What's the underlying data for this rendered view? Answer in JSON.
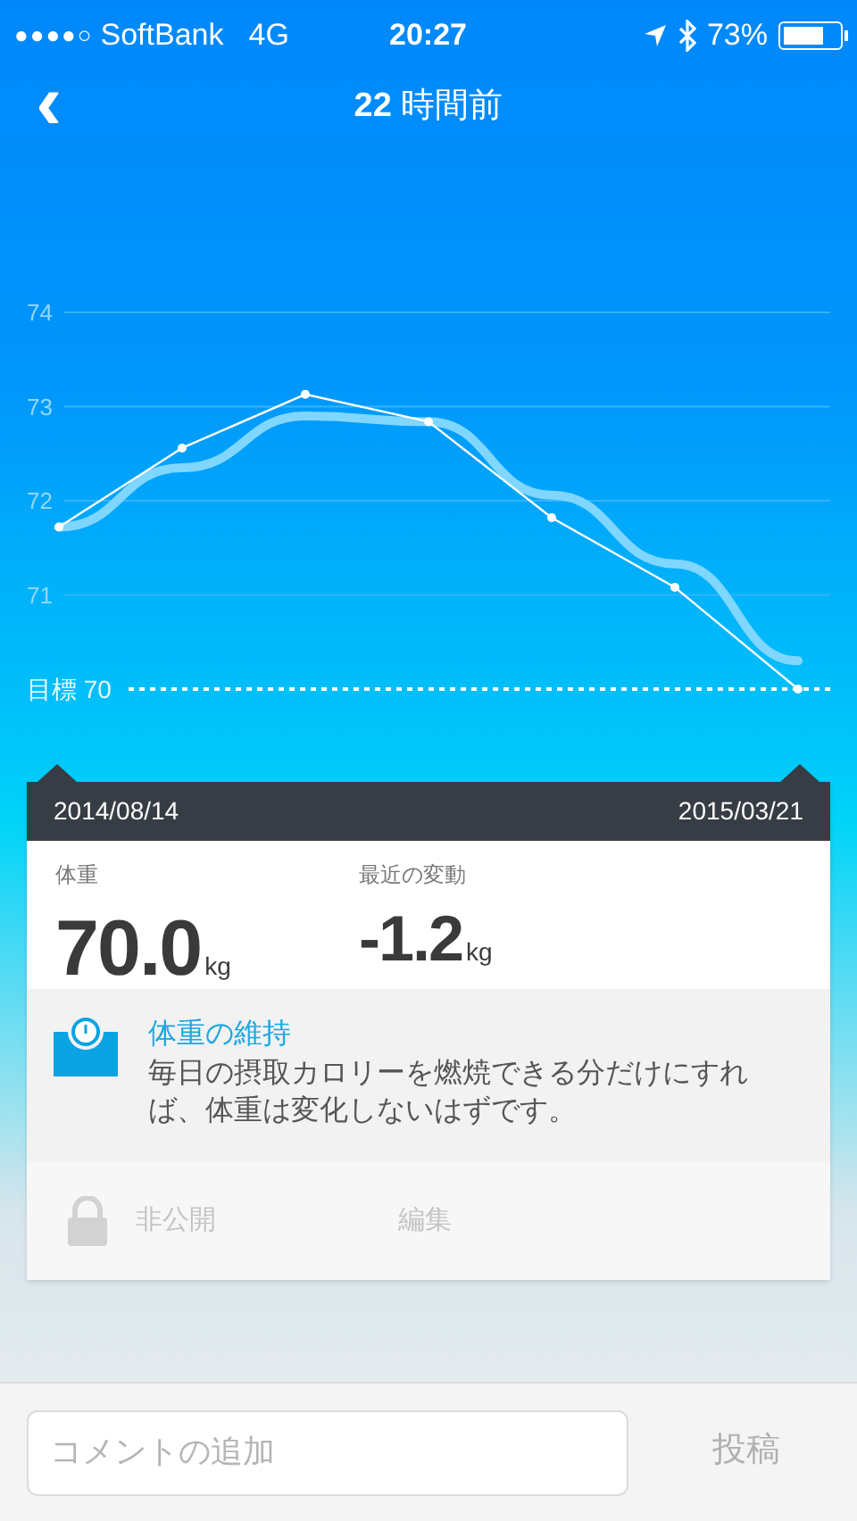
{
  "status_bar": {
    "signal_dots": "●●●●○",
    "carrier": "SoftBank",
    "network": "4G",
    "time": "20:27",
    "battery": "73%"
  },
  "nav": {
    "back": "‹",
    "title_number": "22",
    "title_text": "時間前"
  },
  "weight_chart": {
    "chart_data": {
      "type": "line",
      "ylim": [
        70,
        74
      ],
      "yticks": [
        {
          "value": 70,
          "label": "目標 70"
        },
        71,
        72,
        73,
        74
      ],
      "grid": true,
      "series": [
        {
          "color": "#ffffff",
          "marker": true,
          "values": [
            71.72,
            72.56,
            73.13,
            72.84,
            71.82,
            71.08,
            70.0
          ]
        },
        {
          "color": "#7fd6ff",
          "marker": false,
          "values": [
            71.72,
            72.35,
            72.9,
            72.84,
            72.06,
            71.33,
            70.3
          ]
        }
      ]
    }
  },
  "range": {
    "start": "2014/08/14",
    "end": "2015/03/21"
  },
  "stats": [
    {
      "label": "体重",
      "value": "70.0",
      "unit": "kg"
    },
    {
      "label": "最近の変動",
      "value": "-1.2",
      "unit": "kg"
    }
  ],
  "tip": {
    "title": "体重の維持",
    "body": "毎日の摂取カロリーを燃焼できる分だけにすれば、体重は変化しないはずです。"
  },
  "actions": [
    {
      "kind": "privacy",
      "label": "非公開"
    },
    {
      "kind": "edit",
      "label": "編集"
    }
  ],
  "comment": {
    "placeholder": "コメントの追加",
    "post": "投稿"
  }
}
